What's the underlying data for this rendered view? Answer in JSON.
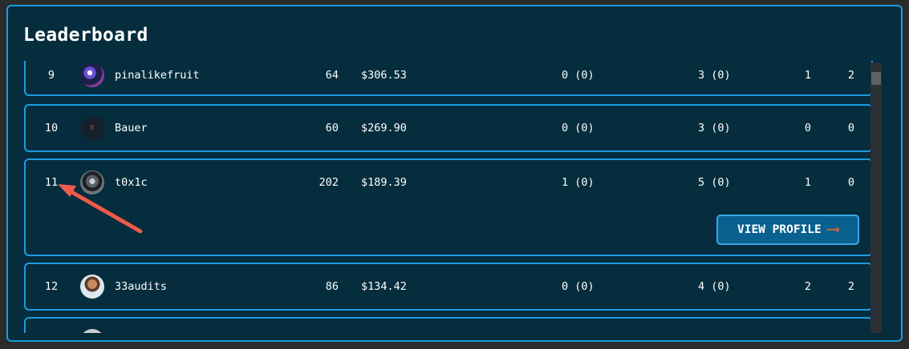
{
  "title": "Leaderboard",
  "rows": [
    {
      "rank": "9",
      "avatar": "pinalikefruit-avatar",
      "name": "pinalikefruit",
      "score": "64",
      "amount": "$306.53",
      "col_a": "0 (0)",
      "col_b": "3 (0)",
      "col_c": "1",
      "col_d": "2"
    },
    {
      "rank": "10",
      "avatar": "bauer-avatar",
      "avatar_text": "B",
      "name": "Bauer",
      "score": "60",
      "amount": "$269.90",
      "col_a": "0 (0)",
      "col_b": "3 (0)",
      "col_c": "0",
      "col_d": "0"
    },
    {
      "rank": "11",
      "avatar": "t0x1c-avatar",
      "name": "t0x1c",
      "score": "202",
      "amount": "$189.39",
      "col_a": "1 (0)",
      "col_b": "5 (0)",
      "col_c": "1",
      "col_d": "0"
    },
    {
      "rank": "12",
      "avatar": "33audits-avatar",
      "name": "33audits",
      "score": "86",
      "amount": "$134.42",
      "col_a": "0 (0)",
      "col_b": "4 (0)",
      "col_c": "2",
      "col_d": "2"
    }
  ],
  "view_profile_label": "VIEW PROFILE",
  "colors": {
    "panel_bg": "#052d3d",
    "border": "#1e9be0",
    "button_bg": "#09618f",
    "arrow_accent": "#e8622c",
    "annotation_arrow": "#f05a4a"
  },
  "icons": {
    "button_arrow": "arrow-right-icon",
    "annotation": "red-pointer-arrow-icon"
  }
}
